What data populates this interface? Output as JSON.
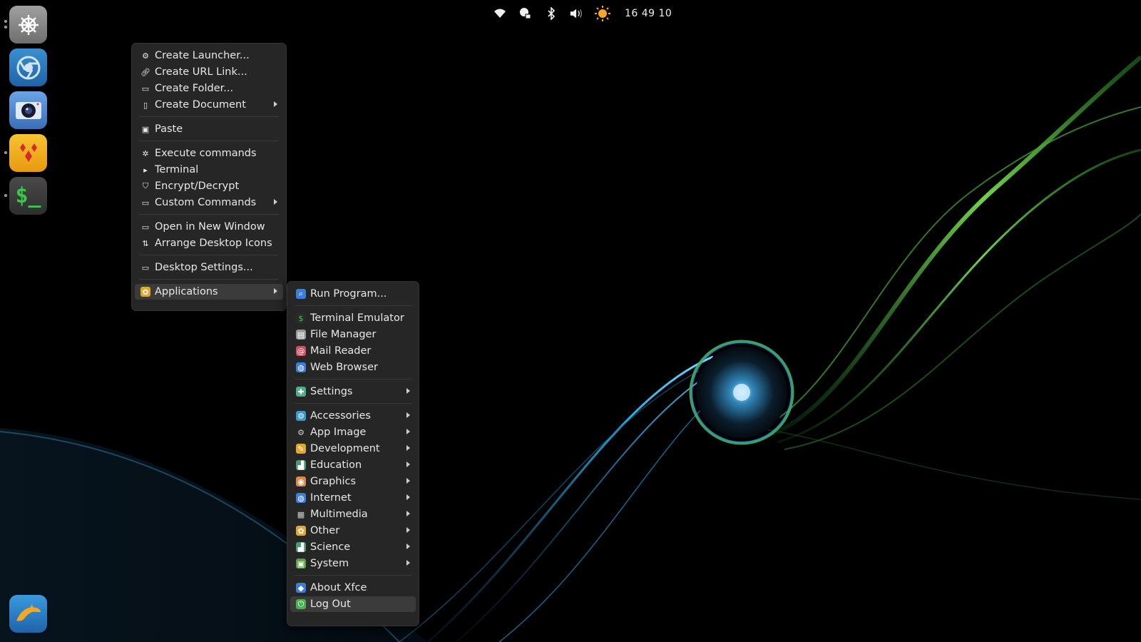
{
  "top_panel": {
    "icons": [
      "wifi-icon",
      "network-lock-icon",
      "bluetooth-icon",
      "volume-icon",
      "weather-sun-icon"
    ],
    "clock": "16 49 10"
  },
  "dock": {
    "items": [
      {
        "name": "settings-helm-icon",
        "color": "#8a8a8a"
      },
      {
        "name": "chromium-icon",
        "color": "#2f7fc1"
      },
      {
        "name": "webcam-icon",
        "color": "#5a8fd6"
      },
      {
        "name": "cards-game-icon",
        "color": "#f2b21c"
      },
      {
        "name": "terminal-icon",
        "color": "#3d3d3d"
      },
      {
        "name": "dolphin-icon",
        "color": "#2f7fc1"
      }
    ]
  },
  "desktop_menu": {
    "items": [
      {
        "label": "Create Launcher...",
        "icon": "gear-icon"
      },
      {
        "label": "Create URL Link...",
        "icon": "link-icon"
      },
      {
        "label": "Create Folder...",
        "icon": "folder-icon"
      },
      {
        "label": "Create Document",
        "icon": "document-icon",
        "submenu": true
      },
      {
        "label": "Paste",
        "icon": "paste-icon"
      },
      {
        "label": "Execute commands",
        "icon": "cog-icon"
      },
      {
        "label": "Terminal",
        "icon": "terminal-icon"
      },
      {
        "label": "Encrypt/Decrypt",
        "icon": "shield-icon"
      },
      {
        "label": "Custom Commands",
        "icon": "folder-icon",
        "submenu": true
      },
      {
        "label": "Open in New Window",
        "icon": "window-icon"
      },
      {
        "label": "Arrange Desktop Icons",
        "icon": "arrange-icon"
      },
      {
        "label": "Desktop Settings...",
        "icon": "monitor-icon"
      },
      {
        "label": "Applications",
        "icon": "applications-icon",
        "submenu": true
      }
    ]
  },
  "apps_menu": {
    "items": [
      {
        "label": "Run Program...",
        "icon": "run-icon",
        "color": "#3b7dd8"
      },
      {
        "label": "Terminal Emulator",
        "icon": "terminal-icon",
        "color": "#2a2a2a"
      },
      {
        "label": "File Manager",
        "icon": "file-manager-icon",
        "color": "#9a9a9a"
      },
      {
        "label": "Mail Reader",
        "icon": "mail-icon",
        "color": "#d9485f"
      },
      {
        "label": "Web Browser",
        "icon": "web-browser-icon",
        "color": "#3b7dd8"
      },
      {
        "label": "Settings",
        "icon": "settings-icon",
        "color": "#4caf8a",
        "submenu": true
      },
      {
        "label": "Accessories",
        "icon": "accessories-icon",
        "color": "#3a9ad0",
        "submenu": true
      },
      {
        "label": "App Image",
        "icon": "gear-icon",
        "color": "#d0d0d0",
        "submenu": true
      },
      {
        "label": "Development",
        "icon": "development-icon",
        "color": "#e0a82e",
        "submenu": true
      },
      {
        "label": "Education",
        "icon": "education-icon",
        "color": "#4a9a6e",
        "submenu": true
      },
      {
        "label": "Graphics",
        "icon": "graphics-icon",
        "color": "#d88a4a",
        "submenu": true
      },
      {
        "label": "Internet",
        "icon": "internet-icon",
        "color": "#3b7dd8",
        "submenu": true
      },
      {
        "label": "Multimedia",
        "icon": "multimedia-icon",
        "color": "#cfcfcf",
        "submenu": true
      },
      {
        "label": "Other",
        "icon": "other-icon",
        "color": "#e0a82e",
        "submenu": true
      },
      {
        "label": "Science",
        "icon": "science-icon",
        "color": "#4a9a6e",
        "submenu": true
      },
      {
        "label": "System",
        "icon": "system-icon",
        "color": "#5aa04a",
        "submenu": true
      },
      {
        "label": "About Xfce",
        "icon": "about-icon",
        "color": "#3b7dd8"
      },
      {
        "label": "Log Out",
        "icon": "logout-icon",
        "color": "#4caf50"
      }
    ]
  }
}
